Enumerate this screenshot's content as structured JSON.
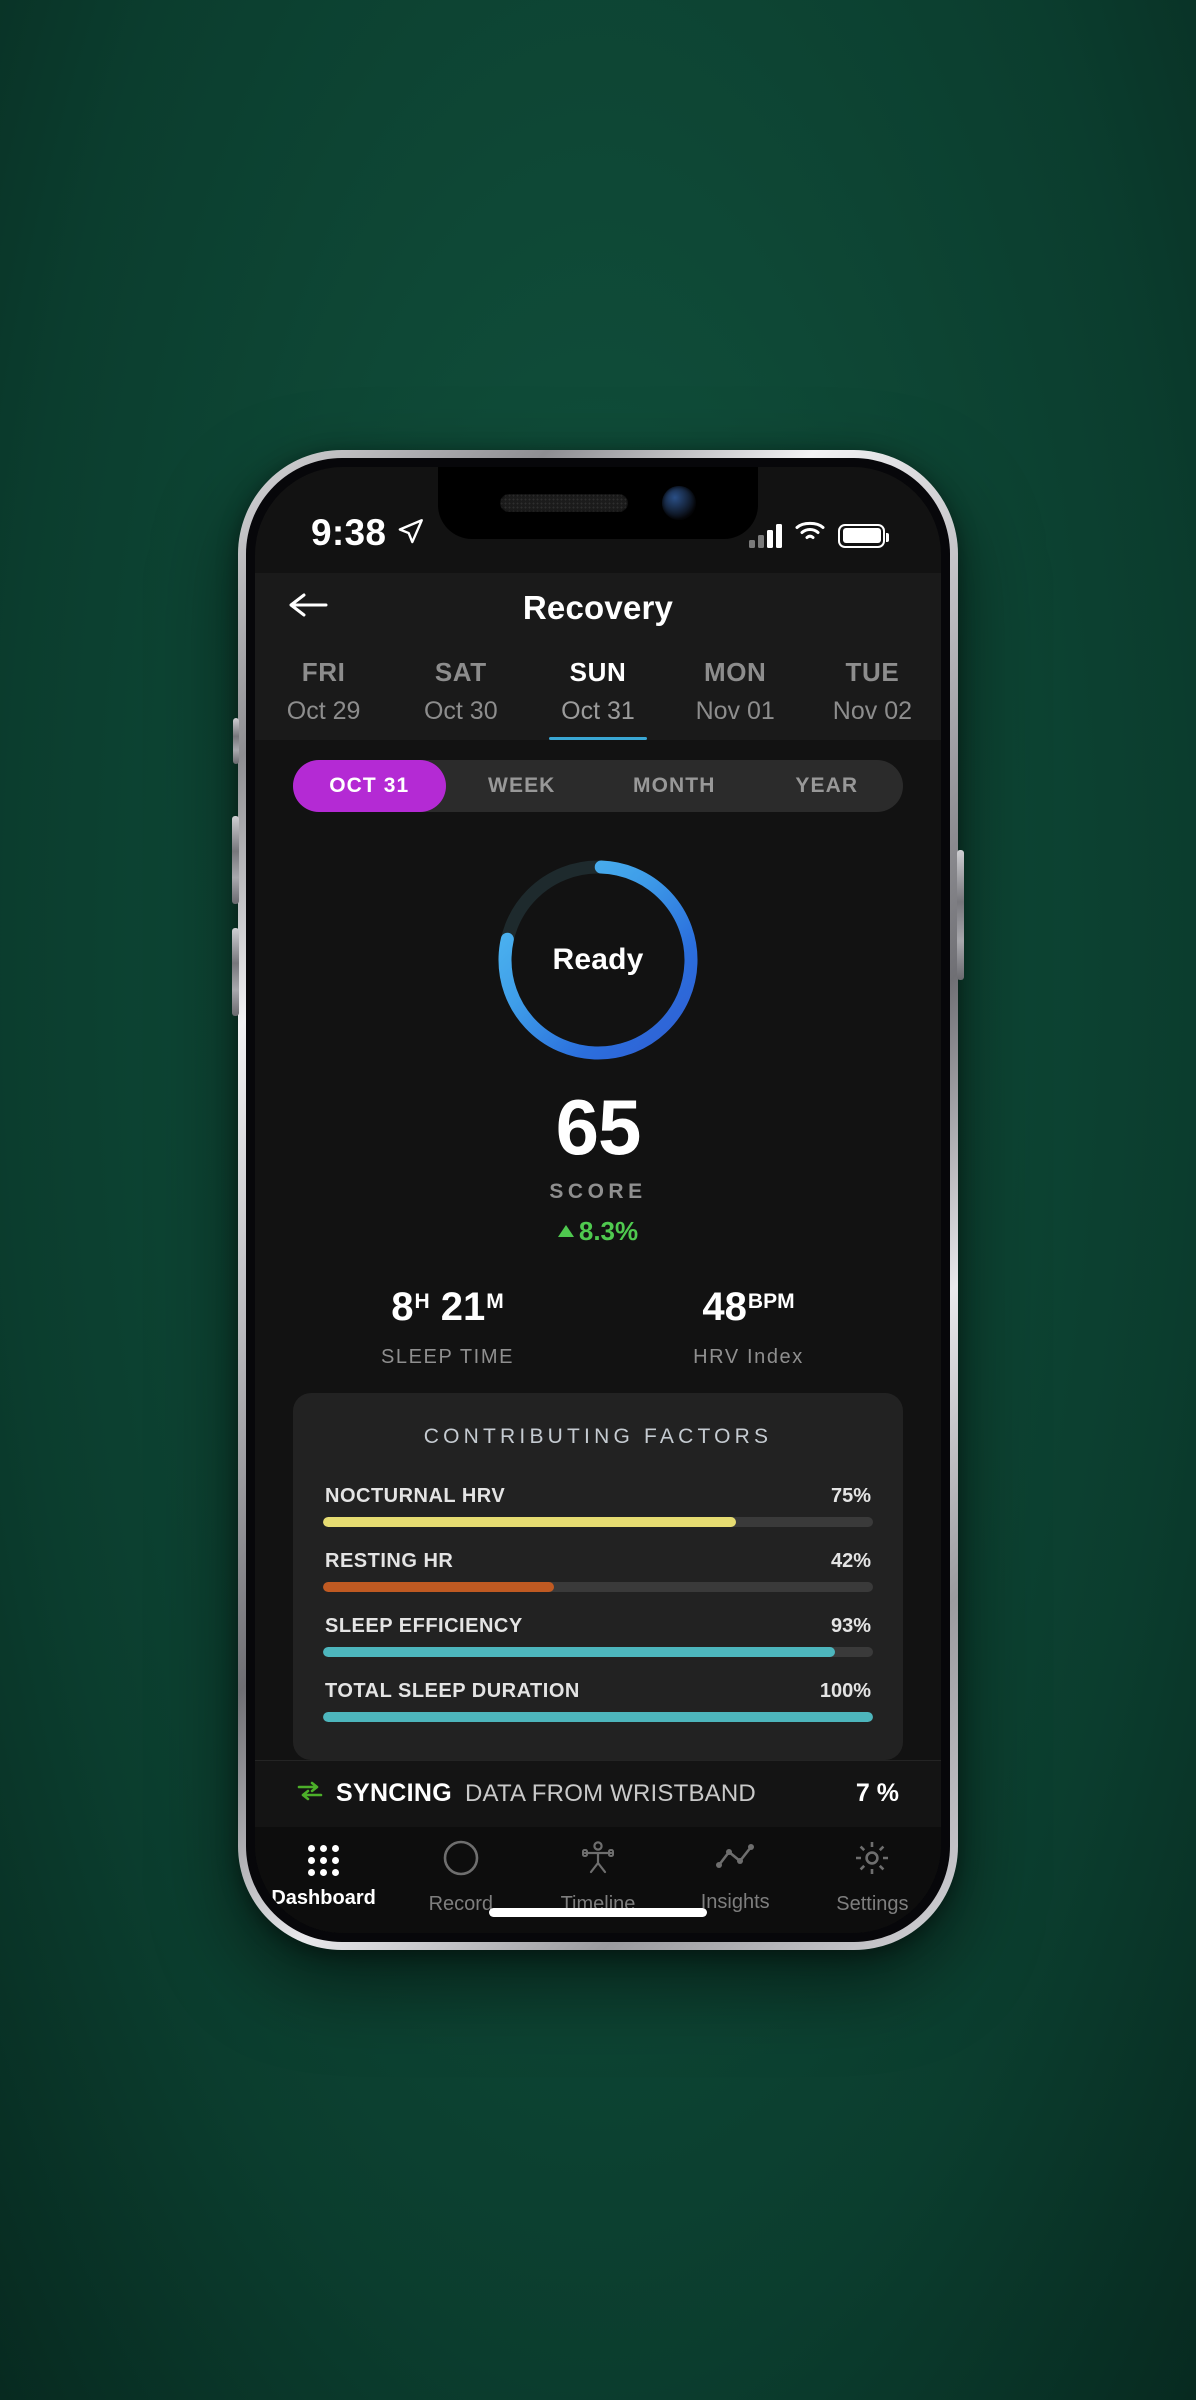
{
  "status_bar": {
    "time": "9:38",
    "location_icon": "location-arrow-icon",
    "signal_icon": "cellular-signal-icon",
    "wifi_icon": "wifi-icon",
    "battery_icon": "battery-icon"
  },
  "nav": {
    "back_icon": "back-arrow-icon",
    "title": "Recovery"
  },
  "dates": [
    {
      "dow": "FRI",
      "date": "Oct 29",
      "active": false
    },
    {
      "dow": "SAT",
      "date": "Oct 30",
      "active": false
    },
    {
      "dow": "SUN",
      "date": "Oct 31",
      "active": true
    },
    {
      "dow": "MON",
      "date": "Nov 01",
      "active": false
    },
    {
      "dow": "TUE",
      "date": "Nov 02",
      "active": false
    }
  ],
  "segments": [
    {
      "label": "OCT 31",
      "active": true
    },
    {
      "label": "WEEK",
      "active": false
    },
    {
      "label": "MONTH",
      "active": false
    },
    {
      "label": "YEAR",
      "active": false
    }
  ],
  "ring": {
    "status_label": "Ready",
    "progress_pct": 78,
    "track_color": "#1e2a2d",
    "gradient_start": "#4fb8ef",
    "gradient_mid": "#2f7fe0",
    "gradient_end": "#2f6fd8"
  },
  "score": {
    "value": "65",
    "label": "SCORE",
    "delta": "8.3%",
    "delta_direction": "up",
    "delta_color": "#4fc94f"
  },
  "stats": [
    {
      "value": "8",
      "unit1": "H",
      "value2": "21",
      "unit2": "M",
      "label": "SLEEP TIME"
    },
    {
      "value": "48",
      "unit1": "BPM",
      "value2": "",
      "unit2": "",
      "label": "HRV Index"
    }
  ],
  "contributing_factors": {
    "title": "CONTRIBUTING FACTORS",
    "items": [
      {
        "name": "NOCTURNAL HRV",
        "pct_label": "75%",
        "pct": 75,
        "color": "#e6dc72"
      },
      {
        "name": "RESTING HR",
        "pct_label": "42%",
        "pct": 42,
        "color": "#c05a22"
      },
      {
        "name": "SLEEP EFFICIENCY",
        "pct_label": "93%",
        "pct": 93,
        "color": "#4db6bd"
      },
      {
        "name": "TOTAL SLEEP DURATION",
        "pct_label": "100%",
        "pct": 100,
        "color": "#4db6bd"
      }
    ]
  },
  "sync": {
    "icon": "sync-arrows-icon",
    "icon_color": "#4caf29",
    "status": "SYNCING",
    "detail": "DATA FROM WRISTBAND",
    "percent": "7 %"
  },
  "tabs": [
    {
      "label": "Dashboard",
      "icon": "grid-dots-icon",
      "active": true
    },
    {
      "label": "Record",
      "icon": "circle-icon",
      "active": false
    },
    {
      "label": "Timeline",
      "icon": "person-icon",
      "active": false
    },
    {
      "label": "Insights",
      "icon": "line-chart-icon",
      "active": false
    },
    {
      "label": "Settings",
      "icon": "gear-icon",
      "active": false
    }
  ],
  "chart_data": {
    "type": "bar",
    "title": "CONTRIBUTING FACTORS",
    "categories": [
      "NOCTURNAL HRV",
      "RESTING HR",
      "SLEEP EFFICIENCY",
      "TOTAL SLEEP DURATION"
    ],
    "values": [
      75,
      42,
      93,
      100
    ],
    "xlabel": "",
    "ylabel": "",
    "ylim": [
      0,
      100
    ],
    "grid": false,
    "legend": "none",
    "colors": [
      "#e6dc72",
      "#c05a22",
      "#4db6bd",
      "#4db6bd"
    ]
  }
}
